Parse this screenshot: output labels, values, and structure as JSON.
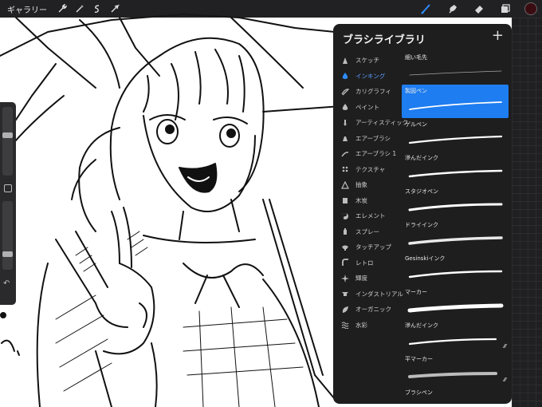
{
  "topbar": {
    "gallery_label": "ギャラリー",
    "left_icons": [
      "wrench-icon",
      "magic-wand-icon",
      "selection-icon",
      "transform-arrow-icon"
    ],
    "right_icons": [
      "brush-icon",
      "smudge-icon",
      "eraser-icon",
      "layers-icon"
    ],
    "current_color": "#3a0c12"
  },
  "brush_library": {
    "title": "ブラシライブラリ",
    "add_label": "+",
    "accent_color": "#1e7df0",
    "categories": [
      {
        "label": "スケッチ",
        "icon": "pencil-tip-icon"
      },
      {
        "label": "インキング",
        "icon": "ink-drop-icon",
        "active": true
      },
      {
        "label": "カリグラフィ",
        "icon": "calligraphy-icon"
      },
      {
        "label": "ペイント",
        "icon": "paint-drop-icon"
      },
      {
        "label": "アーティスティック",
        "icon": "brush-tip-icon"
      },
      {
        "label": "エアーブラシ",
        "icon": "airbrush-icon"
      },
      {
        "label": "エアーブラシ 1",
        "icon": "stroke-icon"
      },
      {
        "label": "テクスチャ",
        "icon": "texture-icon"
      },
      {
        "label": "抽象",
        "icon": "triangle-icon"
      },
      {
        "label": "木炭",
        "icon": "charcoal-icon"
      },
      {
        "label": "エレメント",
        "icon": "yin-yang-icon"
      },
      {
        "label": "スプレー",
        "icon": "spray-can-icon"
      },
      {
        "label": "タッチアップ",
        "icon": "touchup-icon"
      },
      {
        "label": "レトロ",
        "icon": "retro-icon"
      },
      {
        "label": "輝度",
        "icon": "sparkle-icon"
      },
      {
        "label": "インダストリアル",
        "icon": "anvil-icon"
      },
      {
        "label": "オーガニック",
        "icon": "leaf-icon"
      },
      {
        "label": "水彩",
        "icon": "wave-icon"
      }
    ],
    "brushes": [
      {
        "name": "細い毛先",
        "selected": false
      },
      {
        "name": "製図ペン",
        "selected": true
      },
      {
        "name": "ゲルペン",
        "selected": false
      },
      {
        "name": "滲んだインク",
        "selected": false
      },
      {
        "name": "スタジオペン",
        "selected": false
      },
      {
        "name": "ドライインク",
        "selected": false
      },
      {
        "name": "Gesinskiインク",
        "selected": false
      },
      {
        "name": "マーカー",
        "selected": false
      },
      {
        "name": "滲んだインク",
        "selected": false
      },
      {
        "name": "平マーカー",
        "selected": false
      },
      {
        "name": "ブラシペン",
        "selected": false
      }
    ]
  },
  "sidebar": {
    "icons": [
      "modify-square-icon",
      "undo-icon"
    ],
    "size_level": 0.6,
    "opacity_level": 0.2
  }
}
